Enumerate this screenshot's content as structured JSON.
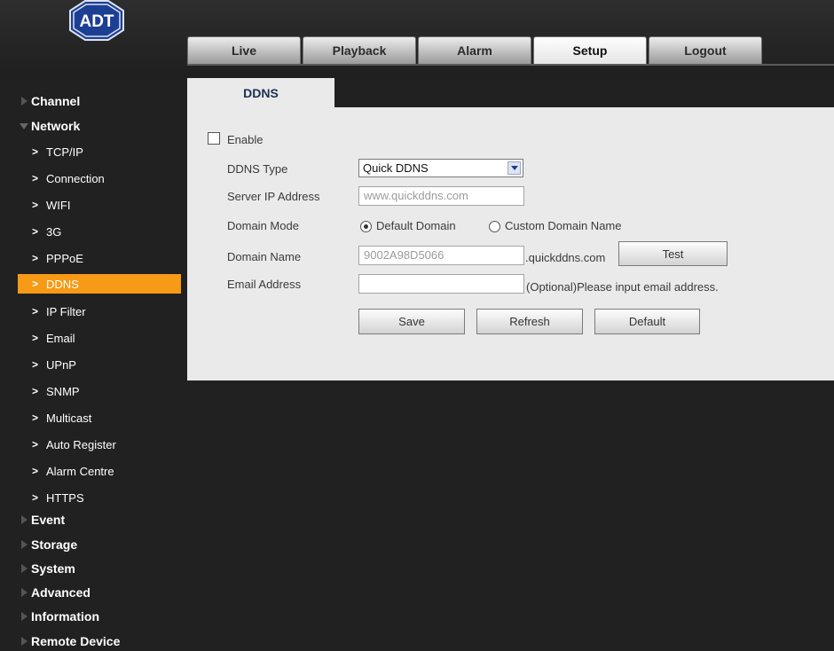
{
  "app": {
    "logo_text": "ADT"
  },
  "nav": {
    "tabs": [
      "Live",
      "Playback",
      "Alarm",
      "Setup",
      "Logout"
    ],
    "active": "Setup"
  },
  "sidebar": {
    "channel": "Channel",
    "network": "Network",
    "network_items": [
      "TCP/IP",
      "Connection",
      "WIFI",
      "3G",
      "PPPoE",
      "DDNS",
      "IP Filter",
      "Email",
      "UPnP",
      "SNMP",
      "Multicast",
      "Auto Register",
      "Alarm Centre",
      "HTTPS"
    ],
    "active_item": "DDNS",
    "bottom": [
      "Event",
      "Storage",
      "System",
      "Advanced",
      "Information",
      "Remote Device"
    ]
  },
  "ddns": {
    "tab_label": "DDNS",
    "enable_label": "Enable",
    "enable_checked": false,
    "type_label": "DDNS Type",
    "type_value": "Quick DDNS",
    "server_label": "Server IP Address",
    "server_value": "www.quickddns.com",
    "mode_label": "Domain Mode",
    "mode_default": "Default Domain",
    "mode_custom": "Custom Domain Name",
    "mode_selected": "Default Domain",
    "domain_label": "Domain Name",
    "domain_value": "9002A98D5066",
    "domain_suffix": ".quickddns.com",
    "test_label": "Test",
    "email_label": "Email Address",
    "email_value": "",
    "email_hint": "(Optional)Please input email address.",
    "save_label": "Save",
    "refresh_label": "Refresh",
    "default_label": "Default"
  },
  "colors": {
    "accent": "#f79a16",
    "background": "#212121",
    "panel": "#eaeaea"
  }
}
